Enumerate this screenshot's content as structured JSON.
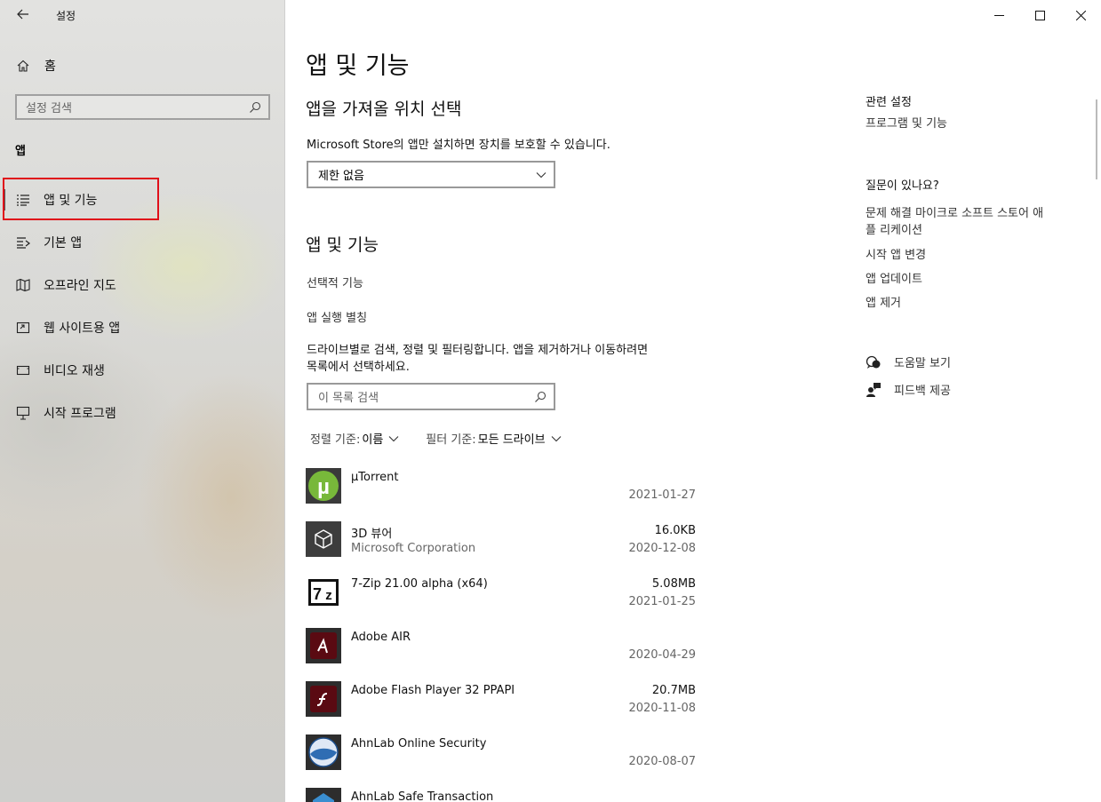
{
  "window": {
    "title": "설정"
  },
  "sidebar": {
    "home_label": "홈",
    "search_placeholder": "설정 검색",
    "section_header": "앱",
    "items": [
      {
        "label": "앱 및 기능",
        "icon": "apps-features-icon",
        "selected": true
      },
      {
        "label": "기본 앱",
        "icon": "default-apps-icon"
      },
      {
        "label": "오프라인 지도",
        "icon": "offline-maps-icon"
      },
      {
        "label": "웹 사이트용 앱",
        "icon": "apps-for-websites-icon"
      },
      {
        "label": "비디오 재생",
        "icon": "video-playback-icon"
      },
      {
        "label": "시작 프로그램",
        "icon": "startup-icon"
      }
    ]
  },
  "main": {
    "title": "앱 및 기능",
    "install_section": {
      "heading": "앱을 가져올 위치 선택",
      "description": "Microsoft Store의 앱만 설치하면 장치를 보호할 수 있습니다.",
      "dropdown_value": "제한 없음"
    },
    "apps_section": {
      "heading": "앱 및 기능",
      "optional_features_link": "선택적 기능",
      "aliases_link": "앱 실행 별칭",
      "description_line1": "드라이브별로 검색, 정렬 및 필터링합니다. 앱을 제거하거나 이동하려면",
      "description_line2": "목록에서 선택하세요.",
      "search_placeholder": "이 목록 검색",
      "sort_label": "정렬 기준:",
      "sort_value": "이름",
      "filter_label": "필터 기준:",
      "filter_value": "모든 드라이브"
    },
    "apps": [
      {
        "name": "µTorrent",
        "publisher": "",
        "size": "",
        "date": "2021-01-27",
        "icon": "utorrent-icon"
      },
      {
        "name": "3D 뷰어",
        "publisher": "Microsoft Corporation",
        "size": "16.0KB",
        "date": "2020-12-08",
        "icon": "3d-viewer-icon"
      },
      {
        "name": "7-Zip 21.00 alpha (x64)",
        "publisher": "",
        "size": "5.08MB",
        "date": "2021-01-25",
        "icon": "7zip-icon"
      },
      {
        "name": "Adobe AIR",
        "publisher": "",
        "size": "",
        "date": "2020-04-29",
        "icon": "adobe-air-icon"
      },
      {
        "name": "Adobe Flash Player 32 PPAPI",
        "publisher": "",
        "size": "20.7MB",
        "date": "2020-11-08",
        "icon": "adobe-flash-icon"
      },
      {
        "name": "AhnLab Online Security",
        "publisher": "",
        "size": "",
        "date": "2020-08-07",
        "icon": "ahnlab-icon"
      },
      {
        "name": "AhnLab Safe Transaction",
        "publisher": "",
        "size": "",
        "date": "",
        "icon": "ahnlab-safe-icon"
      }
    ]
  },
  "related": {
    "heading": "관련 설정",
    "programs_link": "프로그램 및 기능",
    "question_heading": "질문이 있나요?",
    "links": [
      "문제 해결 마이크로 소프트 스토어 애",
      "플 리케이션",
      "시작 앱 변경",
      "앱 업데이트",
      "앱 제거"
    ],
    "help_label": "도움말 보기",
    "feedback_label": "피드백 제공"
  }
}
